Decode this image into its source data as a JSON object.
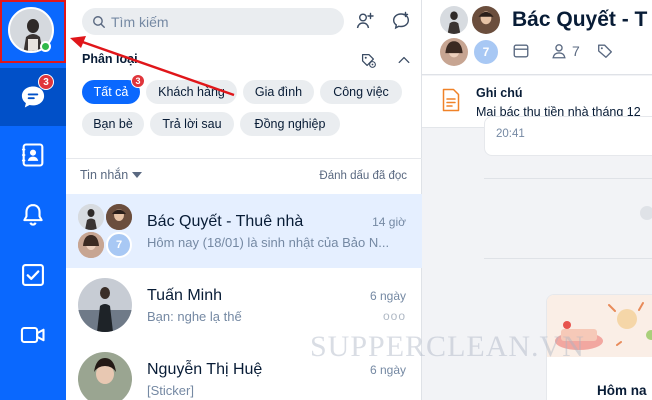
{
  "rail": {
    "messages_badge": "3"
  },
  "search": {
    "placeholder": "Tìm kiếm"
  },
  "category": {
    "header": "Phân loại",
    "chips": [
      {
        "label": "Tất cả",
        "badge": "3",
        "active": true
      },
      {
        "label": "Khách hàng"
      },
      {
        "label": "Gia đình"
      },
      {
        "label": "Công việc"
      },
      {
        "label": "Bạn bè"
      },
      {
        "label": "Trả lời sau"
      },
      {
        "label": "Đồng nghiệp"
      }
    ]
  },
  "list": {
    "filter_label": "Tin nhắn",
    "mark_read": "Đánh dấu đã đọc",
    "conversations": [
      {
        "name": "Bác Quyết - Thuê nhà",
        "preview": "Hôm nay (18/01) là sinh nhật của Bảo N...",
        "time": "14 giờ",
        "group_count": "7"
      },
      {
        "name": "Tuấn Minh",
        "preview": "Bạn: nghe lạ thế",
        "time": "6 ngày",
        "more": "ooo"
      },
      {
        "name": "Nguyễn Thị Huệ",
        "preview": "[Sticker]",
        "time": "6 ngày"
      }
    ]
  },
  "chat": {
    "title": "Bác Quyết - T",
    "group_count": "7",
    "member_count": "7",
    "note_title": "Ghi chú",
    "note_text": "Mai bác thu tiền nhà tháng 12",
    "msg_time": "20:41",
    "card_text": "Hôm na"
  },
  "watermark": "SUPPERCLEAN.VN",
  "colors": {
    "brand": "#0a68fe",
    "rail_active": "#0150c8",
    "badge": "#e0353b",
    "highlight": "#e0161a",
    "active_row": "#e5efff"
  }
}
